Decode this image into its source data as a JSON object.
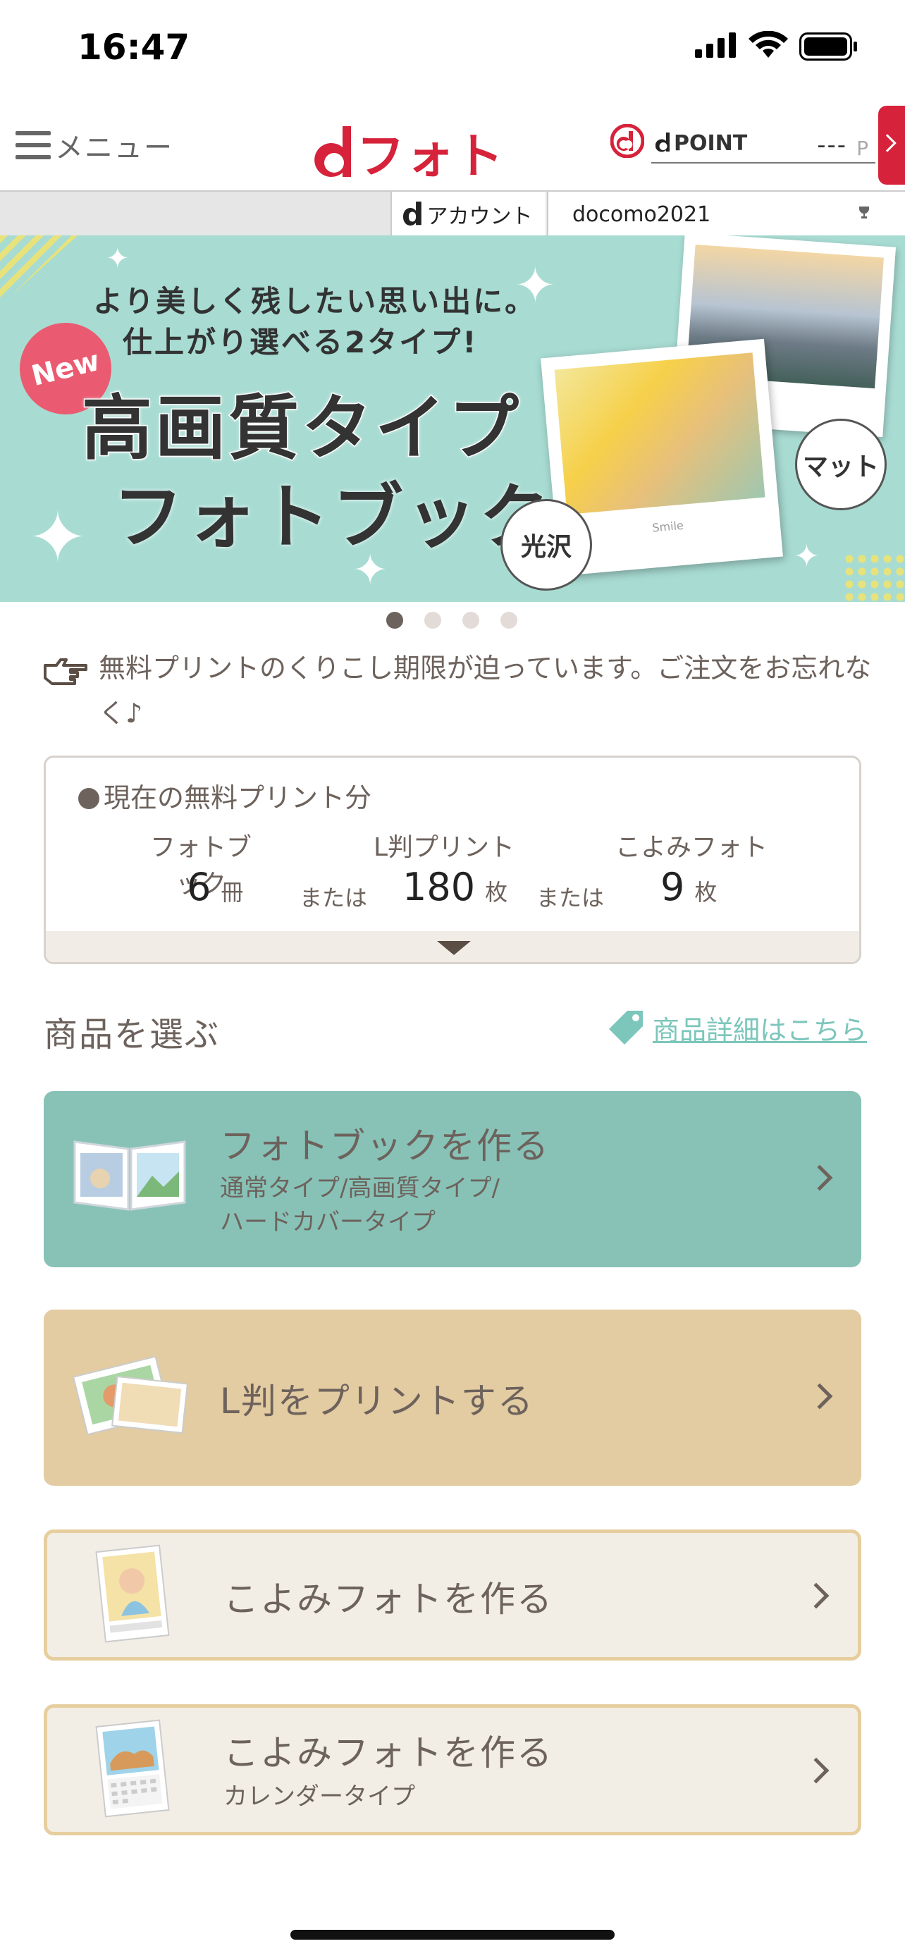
{
  "status_bar": {
    "time": "16:47"
  },
  "header": {
    "menu_label": "メニュー",
    "logo_d": "d",
    "logo_text": "フォト",
    "dpoint_label": "POINT",
    "dpoint_value": "---",
    "dpoint_unit": "P"
  },
  "account": {
    "label_d": "d",
    "label": "アカウント",
    "user_id": "docomo2021"
  },
  "banner": {
    "line1": "より美しく残したい思い出に。",
    "line2": "仕上がり選べる2タイプ!",
    "new_badge": "New",
    "title1": "高画質タイプ",
    "title2": "フォトブック",
    "tag_gloss": "光沢",
    "tag_matte": "マット",
    "photo_caption": "Smile"
  },
  "pager": {
    "count": 4,
    "active": 0
  },
  "notice": {
    "text": "無料プリントのくりこし期限が迫っています。ご注文をお忘れなく♪"
  },
  "free_prints": {
    "title": "現在の無料プリント分",
    "items": [
      {
        "name": "フォトブック",
        "value": "6",
        "unit": "冊"
      },
      {
        "name": "L判プリント",
        "value": "180",
        "unit": "枚"
      },
      {
        "name": "こよみフォト",
        "value": "9",
        "unit": "枚"
      }
    ],
    "or_label": "または"
  },
  "products": {
    "title": "商品を選ぶ",
    "detail_link": "商品詳細はこちら",
    "cards": [
      {
        "title": "フォトブックを作る",
        "sub1": "通常タイプ/高画質タイプ/",
        "sub2": "ハードカバータイプ"
      },
      {
        "title": "L判をプリントする"
      },
      {
        "title": "こよみフォトを作る"
      },
      {
        "title": "こよみフォトを作る",
        "sub1": "カレンダータイプ"
      }
    ]
  },
  "colors": {
    "brand_red": "#d6223a",
    "banner_bg": "#a8dcd3",
    "photobook_card": "#88c2b7",
    "lprint_card": "#e3cba2",
    "koyomi_card": "#f2eee6",
    "link": "#7cc6bb"
  }
}
